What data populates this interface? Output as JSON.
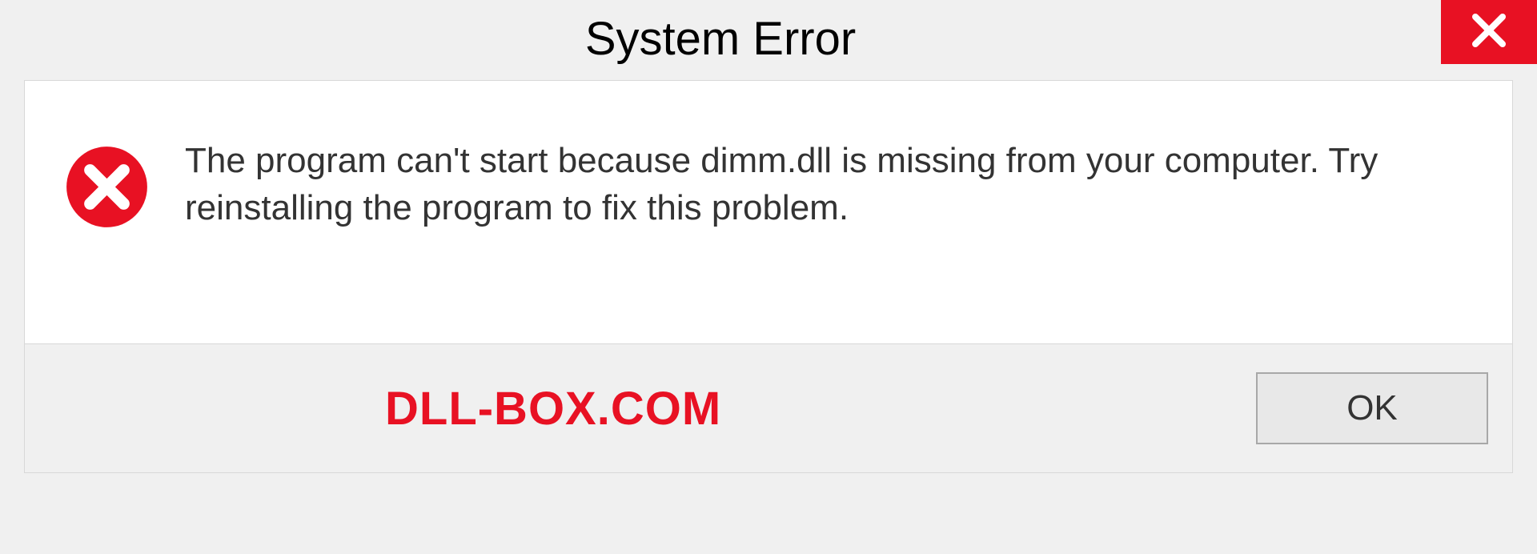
{
  "dialog": {
    "title": "System Error",
    "message": "The program can't start because dimm.dll is missing from your computer. Try reinstalling the program to fix this problem.",
    "ok_label": "OK",
    "watermark": "DLL-BOX.COM"
  }
}
